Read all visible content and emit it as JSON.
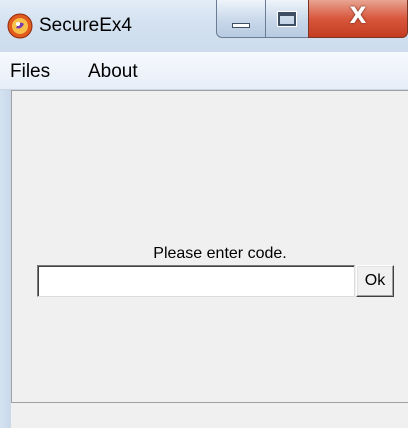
{
  "window": {
    "title": "SecureEx4",
    "icon": "app-logo-icon",
    "minimize_icon": "minimize-icon",
    "maximize_icon": "maximize-icon",
    "close_icon": "close-icon",
    "close_glyph": "X"
  },
  "menu": {
    "items": [
      {
        "label": "Files"
      },
      {
        "label": "About"
      }
    ]
  },
  "form": {
    "prompt": "Please enter code.",
    "code_value": "",
    "ok_label": "Ok"
  },
  "colors": {
    "titlebar": "#d3e1f0",
    "close_button": "#d8573d",
    "client_background": "#f0f0f0"
  }
}
